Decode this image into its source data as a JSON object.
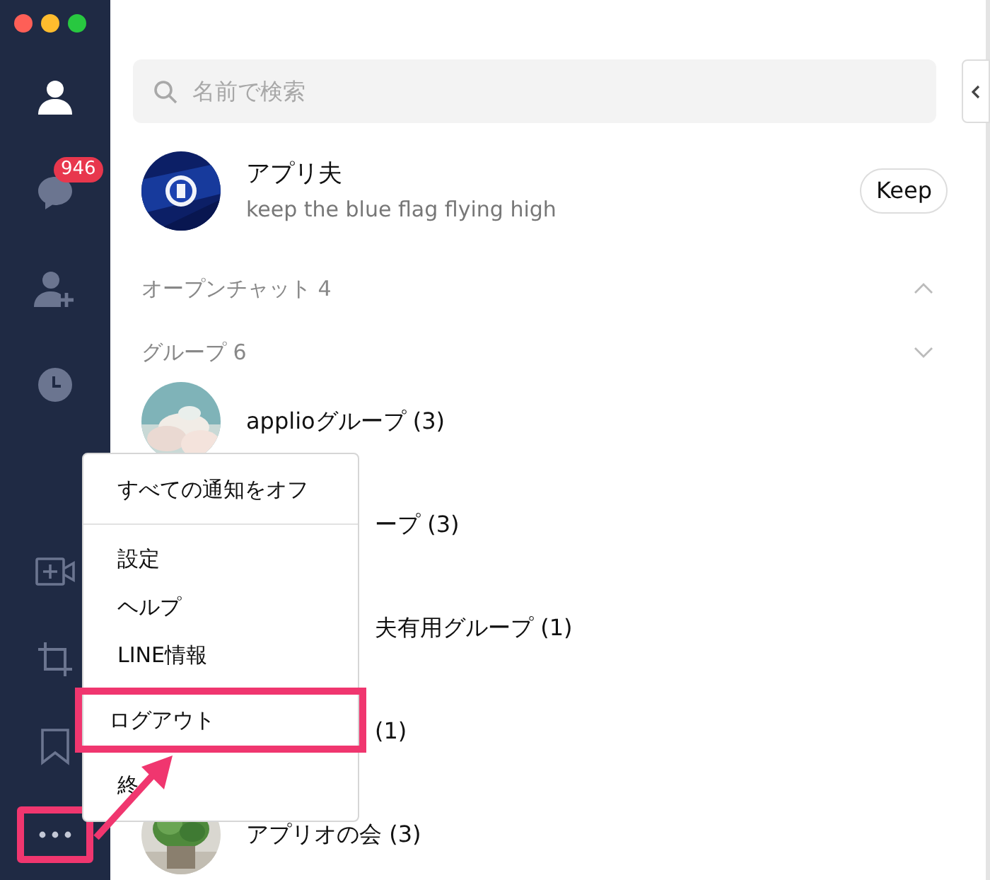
{
  "sidebar": {
    "top_items": [
      {
        "kind": "friends",
        "selected": true
      },
      {
        "kind": "chats",
        "selected": false,
        "badge": "946"
      },
      {
        "kind": "add_friend",
        "selected": false
      },
      {
        "kind": "timeline",
        "selected": false
      }
    ],
    "bottom_items": [
      {
        "kind": "video",
        "highlighted": false
      },
      {
        "kind": "crop",
        "highlighted": false
      },
      {
        "kind": "keep",
        "highlighted": false
      },
      {
        "kind": "more",
        "highlighted": true
      }
    ]
  },
  "search": {
    "placeholder": "名前で検索"
  },
  "profile": {
    "name": "アプリ夫",
    "status": "keep the blue flag flying high",
    "button": "Keep"
  },
  "sections": [
    {
      "label": "オープンチャット 4",
      "expanded": true
    },
    {
      "label": "グループ 6",
      "expanded": false
    }
  ],
  "groups": [
    {
      "kind": "full",
      "name": "applioグループ (3)"
    },
    {
      "kind": "covered",
      "name": "ープ (3)"
    },
    {
      "kind": "covered",
      "name": "夫有用グループ (1)"
    },
    {
      "kind": "covered",
      "name": "(1)"
    },
    {
      "kind": "full",
      "name": "アプリオの会 (3)"
    }
  ],
  "menu": {
    "items": [
      {
        "label": "すべての通知をオフ",
        "highlighted": false,
        "divider_after": true
      },
      {
        "label": "設定",
        "highlighted": false,
        "divider_after": false
      },
      {
        "label": "ヘルプ",
        "highlighted": false,
        "divider_after": false
      },
      {
        "label": "LINE情報",
        "highlighted": false,
        "divider_after": false
      },
      {
        "label": "ログアウト",
        "highlighted": true,
        "divider_after": false
      },
      {
        "label": "終",
        "highlighted": false,
        "divider_after": false
      }
    ]
  }
}
